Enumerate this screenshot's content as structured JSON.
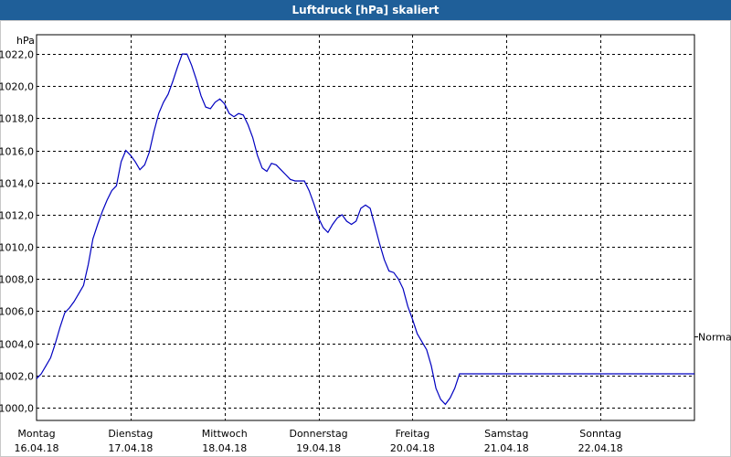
{
  "title": "Luftdruck [hPa] skaliert",
  "colors": {
    "titlebar": "#1f5f99",
    "series": "#0000c0",
    "grid": "#000000",
    "background": "#ffffff"
  },
  "chart_data": {
    "type": "line",
    "title": "Luftdruck [hPa] skaliert",
    "ylabel": "hPa",
    "ylim": [
      999.2,
      1023.2
    ],
    "xlim": [
      0,
      7
    ],
    "grid": true,
    "yticks": [
      "1000,0",
      "1002,0",
      "1004,0",
      "1006,0",
      "1008,0",
      "1010,0",
      "1012,0",
      "1014,0",
      "1016,0",
      "1018,0",
      "1020,0",
      "1022,0"
    ],
    "ytick_values": [
      1000,
      1002,
      1004,
      1006,
      1008,
      1010,
      1012,
      1014,
      1016,
      1018,
      1020,
      1022
    ],
    "xticks": [
      {
        "day": "Montag",
        "date": "16.04.18",
        "x": 0
      },
      {
        "day": "Dienstag",
        "date": "17.04.18",
        "x": 1
      },
      {
        "day": "Mittwoch",
        "date": "18.04.18",
        "x": 2
      },
      {
        "day": "Donnerstag",
        "date": "19.04.18",
        "x": 3
      },
      {
        "day": "Freitag",
        "date": "20.04.18",
        "x": 4
      },
      {
        "day": "Samstag",
        "date": "21.04.18",
        "x": 5
      },
      {
        "day": "Sonntag",
        "date": "22.04.18",
        "x": 6
      }
    ],
    "reference_line": {
      "label": "Normal",
      "value": 1004.4
    },
    "series": [
      {
        "x": [
          0,
          0.05,
          0.1,
          0.15,
          0.2,
          0.25,
          0.3,
          0.35,
          0.4,
          0.45,
          0.5,
          0.55,
          0.6,
          0.65,
          0.7,
          0.75,
          0.8,
          0.85,
          0.9,
          0.95,
          1.0,
          1.05,
          1.1,
          1.15,
          1.2,
          1.25,
          1.3,
          1.35,
          1.4,
          1.45,
          1.5,
          1.55,
          1.6,
          1.65,
          1.7,
          1.75,
          1.8,
          1.85,
          1.9,
          1.95,
          2.0,
          2.05,
          2.1,
          2.15,
          2.2,
          2.25,
          2.3,
          2.35,
          2.4,
          2.45,
          2.5,
          2.55,
          2.6,
          2.65,
          2.7,
          2.75,
          2.8,
          2.85,
          2.9,
          2.95,
          3.0,
          3.05,
          3.1,
          3.15,
          3.2,
          3.25,
          3.3,
          3.35,
          3.4,
          3.45,
          3.5,
          3.55,
          3.6,
          3.65,
          3.7,
          3.75,
          3.8,
          3.85,
          3.9,
          3.95,
          4.0,
          4.05,
          4.1,
          4.15,
          4.2,
          4.25,
          4.3,
          4.35,
          4.4,
          4.45,
          4.5,
          4.55,
          4.6,
          4.65,
          4.7,
          4.75,
          4.8,
          4.85,
          4.9,
          4.95,
          5.0,
          5.05,
          5.1,
          5.15,
          5.2,
          5.25,
          5.3,
          5.35,
          5.4,
          5.45,
          5.5,
          5.55,
          5.6,
          5.65,
          5.7,
          5.75,
          5.8,
          5.85,
          5.9,
          5.95,
          6.0,
          6.05,
          6.1,
          6.15,
          6.2,
          6.25,
          6.3,
          6.35,
          6.4,
          6.45,
          6.5,
          6.55,
          6.6,
          6.65,
          6.7,
          6.75,
          6.8,
          6.85,
          6.9,
          6.95,
          7.0
        ],
        "values": [
          1001.8,
          1002.1,
          1002.6,
          1003.1,
          1004.0,
          1005.0,
          1005.9,
          1006.2,
          1006.6,
          1007.1,
          1007.6,
          1008.9,
          1010.5,
          1011.4,
          1012.2,
          1012.9,
          1013.5,
          1013.8,
          1015.3,
          1016.0,
          1015.7,
          1015.3,
          1014.8,
          1015.1,
          1015.9,
          1017.2,
          1018.3,
          1019.0,
          1019.5,
          1020.3,
          1021.2,
          1022.0,
          1022.0,
          1021.3,
          1020.4,
          1019.4,
          1018.7,
          1018.6,
          1019.0,
          1019.2,
          1018.9,
          1018.3,
          1018.1,
          1018.3,
          1018.2,
          1017.6,
          1016.8,
          1015.7,
          1014.9,
          1014.7,
          1015.2,
          1015.1,
          1014.8,
          1014.5,
          1014.2,
          1014.1,
          1014.1,
          1014.1,
          1013.5,
          1012.7,
          1011.8,
          1011.2,
          1010.9,
          1011.4,
          1011.8,
          1012.0,
          1011.6,
          1011.4,
          1011.6,
          1012.4,
          1012.6,
          1012.4,
          1011.3,
          1010.2,
          1009.2,
          1008.5,
          1008.4,
          1008.0,
          1007.4,
          1006.3,
          1005.5,
          1004.6,
          1004.1,
          1003.6,
          1002.6,
          1001.2,
          1000.5,
          1000.2,
          1000.6,
          1001.2,
          1002.1,
          1002.1,
          1002.1,
          1002.1,
          1002.1,
          1002.1,
          1002.1,
          1002.1,
          1002.1,
          1002.1,
          1002.1,
          1002.1,
          1002.1,
          1002.1,
          1002.1,
          1002.1,
          1002.1,
          1002.1,
          1002.1,
          1002.1,
          1002.1,
          1002.1,
          1002.1,
          1002.1,
          1002.1,
          1002.1,
          1002.1,
          1002.1,
          1002.1,
          1002.1,
          1002.1,
          1002.1,
          1002.1,
          1002.1,
          1002.1,
          1002.1,
          1002.1,
          1002.1,
          1002.1,
          1002.1,
          1002.1,
          1002.1,
          1002.1,
          1002.1,
          1002.1,
          1002.1,
          1002.1,
          1002.1,
          1002.1,
          1002.1,
          1002.1
        ]
      }
    ]
  }
}
